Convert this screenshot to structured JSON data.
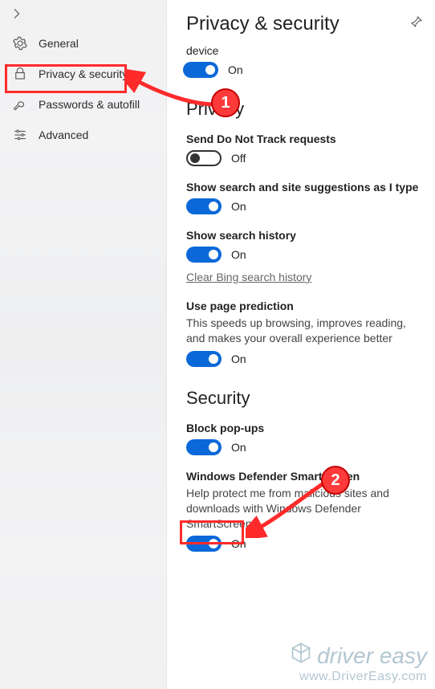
{
  "header": {
    "title": "Privacy & security"
  },
  "sidebar": {
    "items": [
      {
        "label": "General"
      },
      {
        "label": "Privacy & security"
      },
      {
        "label": "Passwords & autofill"
      },
      {
        "label": "Advanced"
      }
    ]
  },
  "truncated_prev": "device",
  "settings_prev_toggle": {
    "state": "On"
  },
  "sections": {
    "privacy": {
      "heading": "Privacy",
      "dnt": {
        "title": "Send Do Not Track requests",
        "state": "Off"
      },
      "suggest": {
        "title": "Show search and site suggestions as I type",
        "state": "On"
      },
      "history": {
        "title": "Show search history",
        "state": "On",
        "link": "Clear Bing search history"
      },
      "prediction": {
        "title": "Use page prediction",
        "desc": "This speeds up browsing, improves reading, and makes your overall experience better",
        "state": "On"
      }
    },
    "security": {
      "heading": "Security",
      "popups": {
        "title": "Block pop-ups",
        "state": "On"
      },
      "smartscreen": {
        "title": "Windows Defender SmartScreen",
        "desc": "Help protect me from malicious sites and downloads with Windows Defender SmartScreen",
        "state": "On"
      }
    }
  },
  "annotations": {
    "badge1": "1",
    "badge2": "2"
  },
  "watermark": {
    "brand": "driver easy",
    "url": "www.DriverEasy.com"
  }
}
